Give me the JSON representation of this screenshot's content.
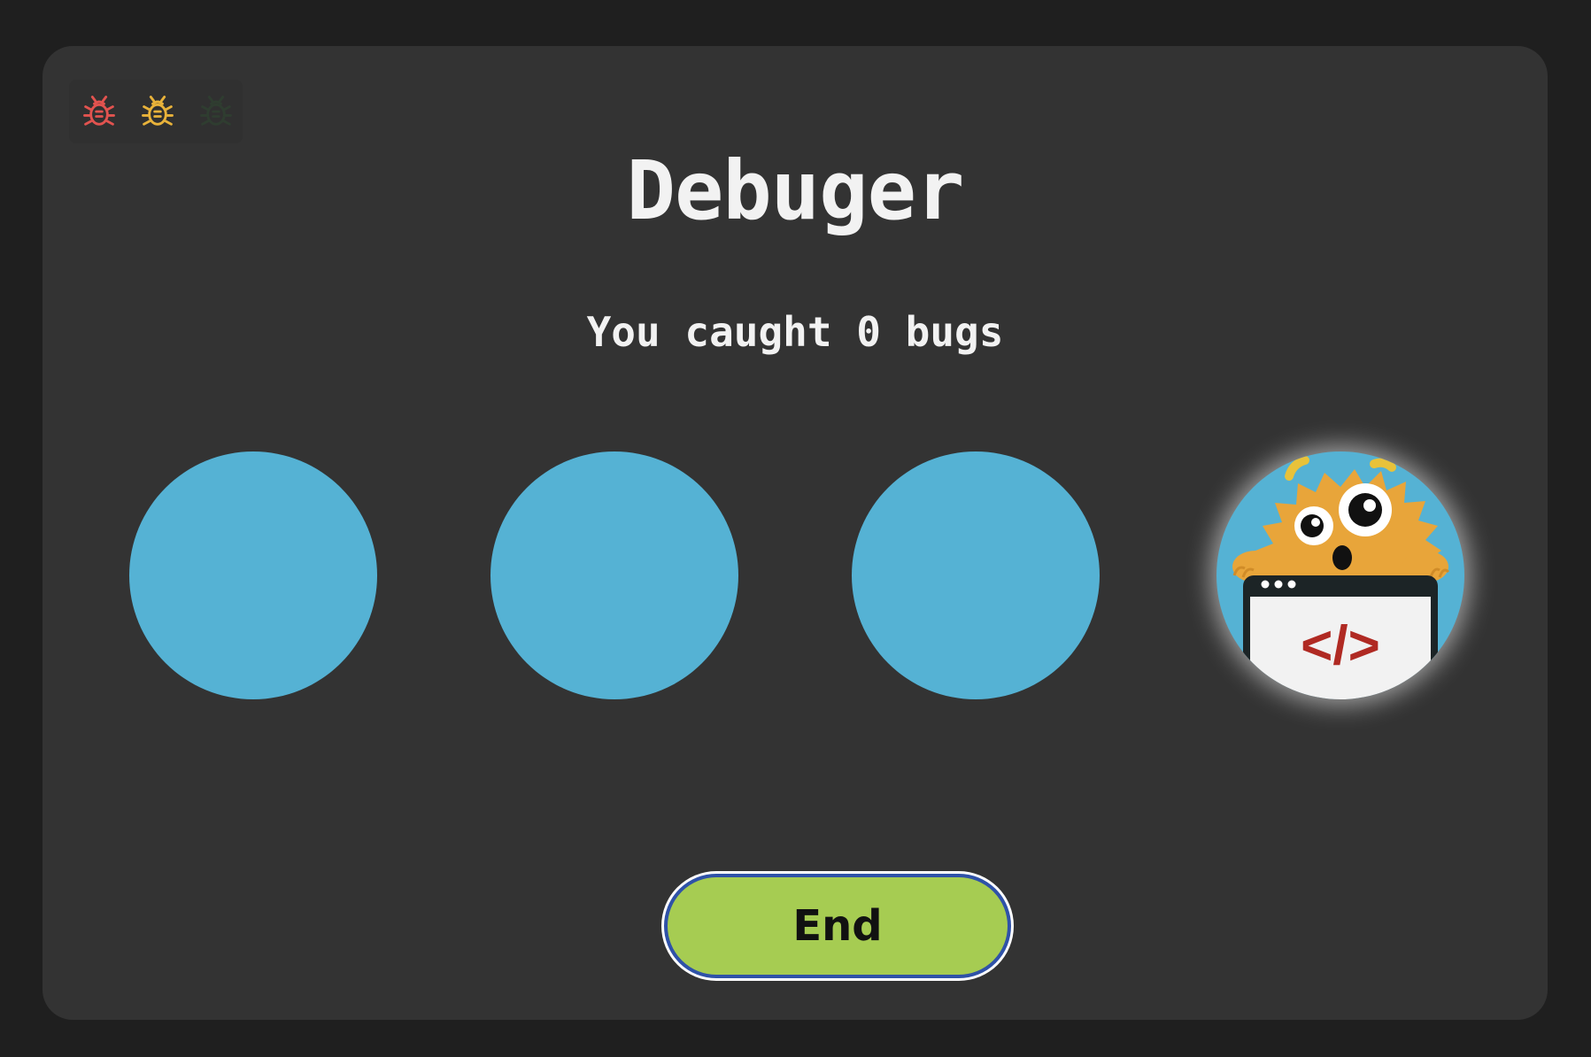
{
  "game": {
    "title": "Debuger",
    "score_text": "You caught 0 bugs",
    "end_button_label": "End"
  },
  "lives": [
    {
      "name": "bug-icon",
      "color": "#e2534f",
      "state": "full"
    },
    {
      "name": "bug-icon",
      "color": "#e8b23a",
      "state": "full"
    },
    {
      "name": "bug-icon",
      "color": "#2f3d30",
      "state": "empty"
    }
  ],
  "holes": [
    {
      "state": "empty"
    },
    {
      "state": "empty"
    },
    {
      "state": "empty"
    },
    {
      "state": "monster",
      "screen_text": "</>"
    }
  ],
  "colors": {
    "background": "#1f1f1f",
    "card": "#333333",
    "hole": "#55b2d4",
    "button": "#a6cc52",
    "button_border": "#2f52a8",
    "monster": "#e8a53a",
    "code_symbol": "#b02a23"
  }
}
